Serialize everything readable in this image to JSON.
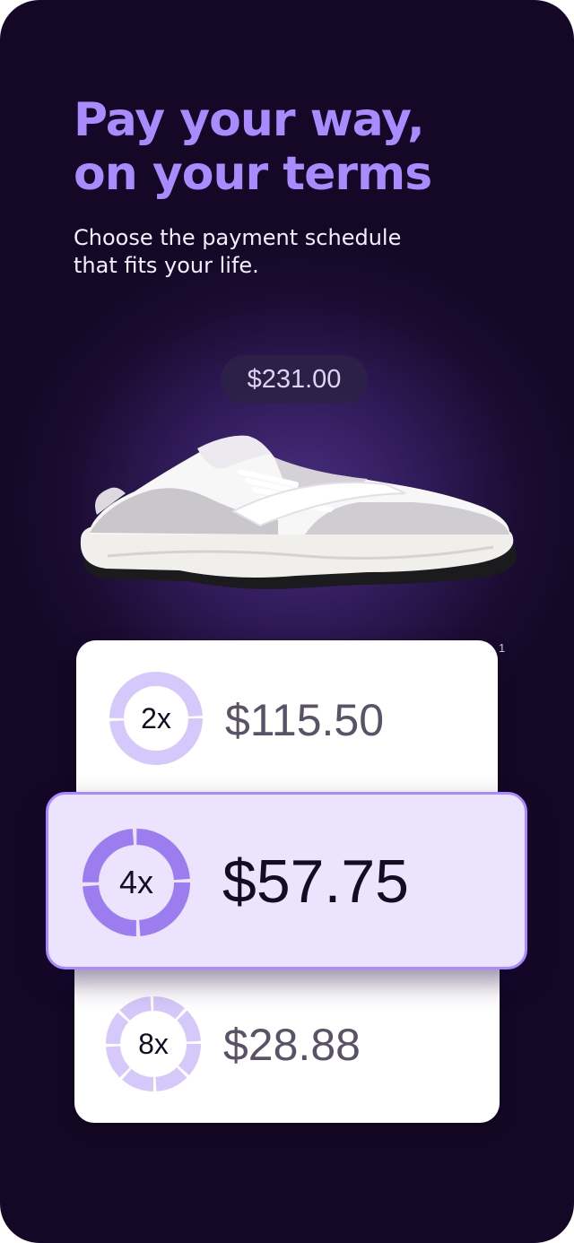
{
  "headline": {
    "line1": "Pay your way,",
    "line2": "on your terms"
  },
  "subtitle": {
    "line1": "Choose the payment schedule",
    "line2": "that fits your life."
  },
  "product": {
    "price": "$231.00",
    "image_icon": "sneaker-image"
  },
  "footnote_marker": "1",
  "plans": [
    {
      "multiplier": "2x",
      "amount": "$115.50",
      "selected": false
    },
    {
      "multiplier": "4x",
      "amount": "$57.75",
      "selected": true
    },
    {
      "multiplier": "8x",
      "amount": "$28.88",
      "selected": false
    }
  ],
  "colors": {
    "accent": "#a98bff",
    "background": "#1a0b30",
    "selected_card": "#ebe3ff",
    "ring_light": "#d5c9fb",
    "ring_selected": "#9b7df0"
  }
}
